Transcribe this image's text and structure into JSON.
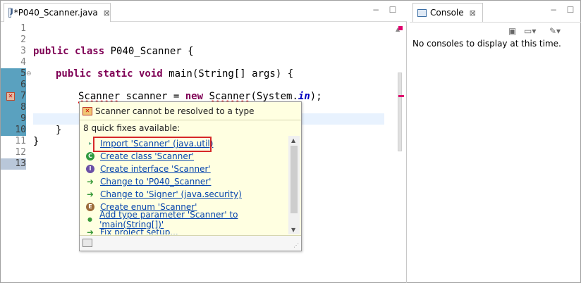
{
  "editor": {
    "tab_title": "*P040_Scanner.java",
    "tab_close": "⊠",
    "minimize": "−",
    "maximize": "☐",
    "line_numbers": [
      "1",
      "2",
      "3",
      "4",
      "5",
      "6",
      "7",
      "8",
      "9",
      "10",
      "11",
      "12",
      "13"
    ],
    "code": {
      "l3_kw": "public class",
      "l3_rest": " P040_Scanner {",
      "l5_kw": "public static void",
      "l5_rest": " main(String[] args) {",
      "l7_a": "Scanner",
      "l7_b": " scanner = ",
      "l7_kw": "new",
      "l7_c": " ",
      "l7_d": "Scanner",
      "l7_e": "(System.",
      "l7_f": "in",
      "l7_g": ");",
      "l10": "}",
      "l11": "}"
    }
  },
  "quickfix": {
    "title": "Scanner cannot be resolved to a type",
    "count": "8 quick fixes available:",
    "items": [
      {
        "label": "Import 'Scanner' (java.util)"
      },
      {
        "label": "Create class 'Scanner'"
      },
      {
        "label": "Create interface 'Scanner'"
      },
      {
        "label": "Change to 'P040_Scanner'"
      },
      {
        "label": "Change to 'Signer' (java.security)"
      },
      {
        "label": "Create enum 'Scanner'"
      },
      {
        "label": "Add type parameter 'Scanner' to 'main(String[])'"
      },
      {
        "label": "Fix project setup..."
      }
    ]
  },
  "console": {
    "tab_title": "Console",
    "tab_close": "⊠",
    "minimize": "−",
    "maximize": "☐",
    "message": "No consoles to display at this time."
  },
  "colors": {
    "keyword": "#7f0055",
    "error_underline": "#e00000",
    "selection_box": "#d62828",
    "popup_bg": "#ffffe1"
  }
}
